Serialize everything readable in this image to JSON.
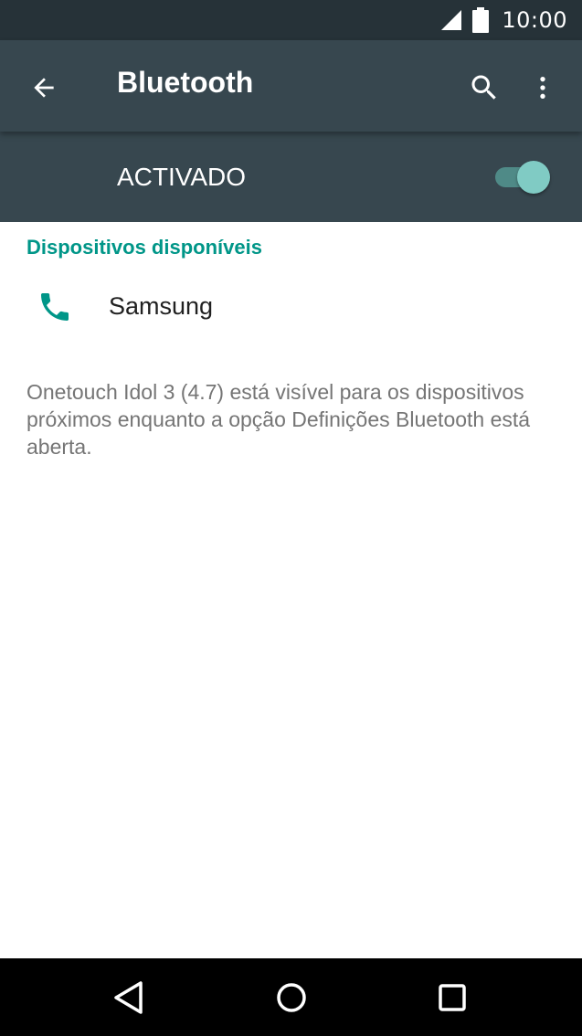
{
  "status_bar": {
    "time": "10:00"
  },
  "toolbar": {
    "title": "Bluetooth",
    "back_icon": "arrow-left-icon",
    "search_icon": "search-icon",
    "more_icon": "more-vert-icon"
  },
  "switch_bar": {
    "label": "ACTIVADO",
    "enabled": true
  },
  "devices": {
    "header": "Dispositivos disponíveis",
    "items": [
      {
        "name": "Samsung",
        "icon": "phone-icon"
      }
    ]
  },
  "footer": {
    "text": "Onetouch Idol 3 (4.7) está visível para os dispositivos próximos enquanto a opção Definições Bluetooth está aberta."
  },
  "colors": {
    "toolbar": "#37474f",
    "status_bar": "#263238",
    "accent": "#009688",
    "toggle_thumb": "#80cbc4"
  }
}
